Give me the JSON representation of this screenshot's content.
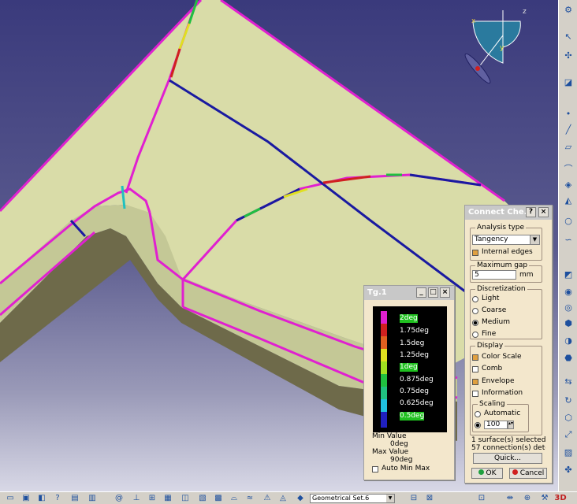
{
  "connect_checker": {
    "title": "Connect Che...",
    "analysis_type": {
      "label": "Analysis type",
      "selected": "Tangency",
      "internal_edges": "Internal edges"
    },
    "maximum_gap": {
      "label": "Maximum gap",
      "value": "5",
      "unit": "mm"
    },
    "discretization": {
      "label": "Discretization",
      "options": [
        "Light",
        "Coarse",
        "Medium",
        "Fine"
      ],
      "selected": "Medium"
    },
    "display": {
      "label": "Display",
      "color_scale": "Color Scale",
      "comb": "Comb",
      "envelope": "Envelope",
      "information": "Information"
    },
    "scaling": {
      "label": "Scaling",
      "automatic": "Automatic",
      "value": "100"
    },
    "status_surfaces": "1 surface(s) selected",
    "status_connections": "57 connection(s) detectec",
    "quick_button": "Quick...",
    "ok_button": "OK",
    "cancel_button": "Cancel"
  },
  "tg_window": {
    "title": "Tg.1",
    "scale_labels": [
      "2deg",
      "1.75deg",
      "1.5deg",
      "1.25deg",
      "1deg",
      "0.875deg",
      "0.75deg",
      "0.625deg",
      "0.5deg"
    ],
    "min_label": "Min Value",
    "min_value": "0deg",
    "max_label": "Max Value",
    "max_value": "90deg",
    "auto_minmax": "Auto Min Max"
  },
  "compass": {
    "x": "x",
    "y": "y",
    "z": "z"
  },
  "bottom_toolbar": {
    "geom_set": "Geometrical Set.6"
  },
  "colors": {
    "background": "#3a3a7c",
    "surface": "#d8dca0",
    "edge_magenta": "#e020d0",
    "edge_blue": "#1a1aa0",
    "dialog": "#f3e7cc"
  }
}
